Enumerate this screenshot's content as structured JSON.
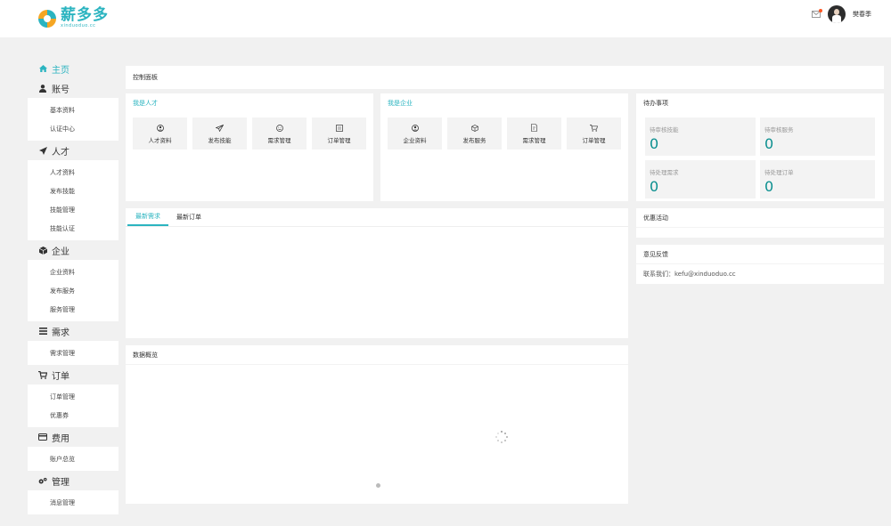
{
  "header": {
    "logo_text": "薪多多",
    "logo_sub": "xinduoduo.cc",
    "username": "樊春季"
  },
  "sidebar": {
    "home": "主页",
    "groups": [
      {
        "title": "账号",
        "items": [
          "基本资料",
          "认证中心"
        ]
      },
      {
        "title": "人才",
        "items": [
          "人才资料",
          "发布技能",
          "技能管理",
          "技能认证"
        ]
      },
      {
        "title": "企业",
        "items": [
          "企业资料",
          "发布服务",
          "服务管理"
        ]
      },
      {
        "title": "需求",
        "items": [
          "需求管理"
        ]
      },
      {
        "title": "订单",
        "items": [
          "订单管理",
          "优惠券"
        ]
      },
      {
        "title": "费用",
        "items": [
          "账户总览"
        ]
      },
      {
        "title": "管理",
        "items": [
          "消息管理"
        ]
      }
    ]
  },
  "dashboard": {
    "title": "控制面板"
  },
  "talent": {
    "title": "我是人才",
    "actions": [
      "人才资料",
      "发布技能",
      "需求管理",
      "订单管理"
    ]
  },
  "enterprise": {
    "title": "我是企业",
    "actions": [
      "企业资料",
      "发布服务",
      "需求管理",
      "订单管理"
    ]
  },
  "todo": {
    "title": "待办事项",
    "items": [
      {
        "label": "待审核技能",
        "value": "0"
      },
      {
        "label": "待审核服务",
        "value": "0"
      },
      {
        "label": "待处理需求",
        "value": "0"
      },
      {
        "label": "待处理订单",
        "value": "0"
      }
    ]
  },
  "latest": {
    "tabs": [
      "最新需求",
      "最新订单"
    ]
  },
  "promo": {
    "title": "优惠活动"
  },
  "feedback": {
    "title": "意见反馈",
    "contact": "联系我们：kefu@xinduoduo.cc"
  },
  "overview": {
    "title": "数据概览"
  },
  "colors": {
    "accent": "#2bb4c0",
    "number": "#0a8f8f"
  }
}
